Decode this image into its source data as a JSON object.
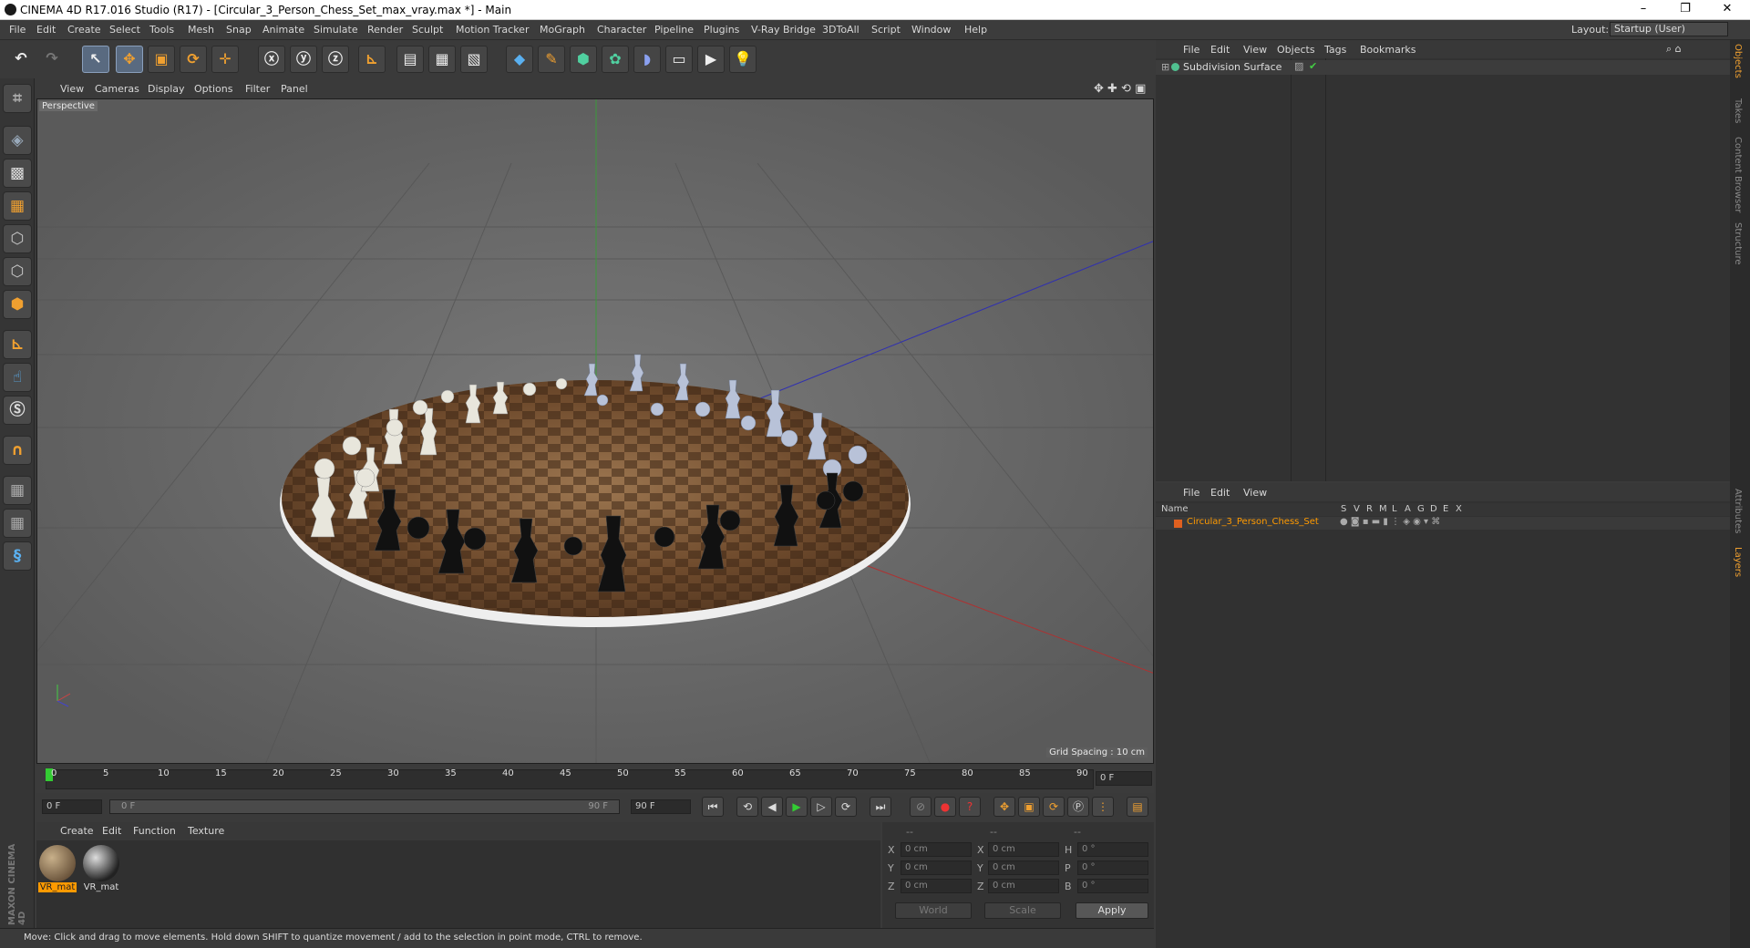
{
  "window": {
    "title": "CINEMA 4D R17.016 Studio (R17) - [Circular_3_Person_Chess_Set_max_vray.max *] - Main",
    "min": "–",
    "restore": "❐",
    "close": "✕"
  },
  "menu": [
    "File",
    "Edit",
    "Create",
    "Select",
    "Tools",
    "Mesh",
    "Snap",
    "Animate",
    "Simulate",
    "Render",
    "Sculpt",
    "Motion Tracker",
    "MoGraph",
    "Character",
    "Pipeline",
    "Plugins",
    "V-Ray Bridge",
    "3DToAll",
    "Script",
    "Window",
    "Help"
  ],
  "layout": {
    "label": "Layout:",
    "value": "Startup (User)"
  },
  "viewport": {
    "menu": [
      "View",
      "Cameras",
      "Display",
      "Options",
      "Filter",
      "Panel"
    ],
    "label": "Perspective",
    "grid_spacing": "Grid Spacing : 10 cm"
  },
  "timeline": {
    "ticks": [
      "0",
      "5",
      "10",
      "15",
      "20",
      "25",
      "30",
      "35",
      "40",
      "45",
      "50",
      "55",
      "60",
      "65",
      "70",
      "75",
      "80",
      "85",
      "90"
    ],
    "current": "0 F"
  },
  "playback": {
    "start": "0 F",
    "slider_start": "0 F",
    "slider_end": "90 F",
    "end": "90 F"
  },
  "material_menu": [
    "Create",
    "Edit",
    "Function",
    "Texture"
  ],
  "materials": [
    {
      "name": "VR_mat"
    },
    {
      "name": "VR_mat"
    }
  ],
  "coords": {
    "header": [
      "--",
      "--",
      "--"
    ],
    "rows": [
      {
        "a": "X",
        "av": "0 cm",
        "b": "X",
        "bv": "0 cm",
        "c": "H",
        "cv": "0 °"
      },
      {
        "a": "Y",
        "av": "0 cm",
        "b": "Y",
        "bv": "0 cm",
        "c": "P",
        "cv": "0 °"
      },
      {
        "a": "Z",
        "av": "0 cm",
        "b": "Z",
        "bv": "0 cm",
        "c": "B",
        "cv": "0 °"
      }
    ],
    "mode1": "World",
    "mode2": "Scale",
    "apply": "Apply"
  },
  "status": "Move: Click and drag to move elements. Hold down SHIFT to quantize movement / add to the selection in point mode, CTRL to remove.",
  "objects_panel": {
    "menu": [
      "File",
      "Edit",
      "View",
      "Objects",
      "Tags",
      "Bookmarks"
    ],
    "item": "Subdivision Surface"
  },
  "layers_panel": {
    "menu": [
      "File",
      "Edit",
      "View"
    ],
    "name_header": "Name",
    "cols": [
      "S",
      "V",
      "R",
      "M",
      "L",
      "A",
      "G",
      "D",
      "E",
      "X"
    ],
    "item": "Circular_3_Person_Chess_Set"
  },
  "side_tabs": [
    "Objects",
    "Takes",
    "Content Browser",
    "Structure",
    "Attributes",
    "Layers"
  ],
  "brand": "MAXON CINEMA 4D",
  "colors": {
    "accent": "#f0a030",
    "layer_color": "#e06020",
    "selected_text": "#ff9a00"
  }
}
